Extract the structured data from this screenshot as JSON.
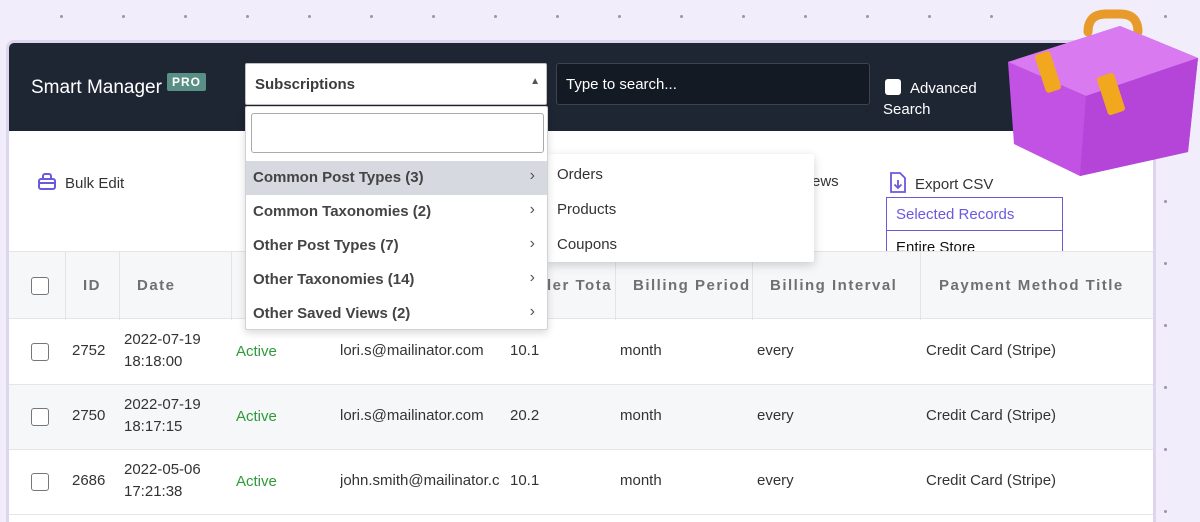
{
  "app": {
    "title": "Smart Manager",
    "badge": "PRO"
  },
  "header": {
    "dashboard_select": "Subscriptions",
    "search_placeholder": "Type to search...",
    "advanced_search_line1": "Advanced",
    "advanced_search_line2": "Search"
  },
  "toolbar": {
    "bulk_edit": "Bulk Edit",
    "views_partial": "ews",
    "export_csv": "Export CSV",
    "export_options": [
      "Selected Records",
      "Entire Store"
    ]
  },
  "dropdown": {
    "items": [
      {
        "label": "Common Post Types (3)"
      },
      {
        "label": "Common Taxonomies (2)"
      },
      {
        "label": "Other Post Types (7)"
      },
      {
        "label": "Other Taxonomies (14)"
      },
      {
        "label": "Other Saved Views (2)"
      }
    ],
    "submenu": [
      "Orders",
      "Products",
      "Coupons"
    ]
  },
  "table": {
    "columns": [
      "ID",
      "Date",
      "der Tota",
      "Billing Period",
      "Billing Interval",
      "Payment Method Title"
    ],
    "rows": [
      {
        "id": "2752",
        "date1": "2022-07-19",
        "date2": "18:18:00",
        "status": "Active",
        "email": "lori.s@mailinator.com",
        "total": "10.1",
        "period": "month",
        "interval": "every",
        "payment": "Credit Card (Stripe)"
      },
      {
        "id": "2750",
        "date1": "2022-07-19",
        "date2": "18:17:15",
        "status": "Active",
        "email": "lori.s@mailinator.com",
        "total": "20.2",
        "period": "month",
        "interval": "every",
        "payment": "Credit Card (Stripe)"
      },
      {
        "id": "2686",
        "date1": "2022-05-06",
        "date2": "17:21:38",
        "status": "Active",
        "email": "john.smith@mailinator.c",
        "total": "10.1",
        "period": "month",
        "interval": "every",
        "payment": "Credit Card (Stripe)"
      }
    ]
  },
  "colors": {
    "header_bg": "#1e2533",
    "active_status": "#2e9a3a",
    "accent": "#6b58e0",
    "briefcase": "#c14ee0"
  },
  "icons": {
    "bulk_edit": "bulk-edit-icon",
    "export": "export-csv-icon",
    "chevron": "chevron-right-icon",
    "caret": "caret-up-icon"
  }
}
